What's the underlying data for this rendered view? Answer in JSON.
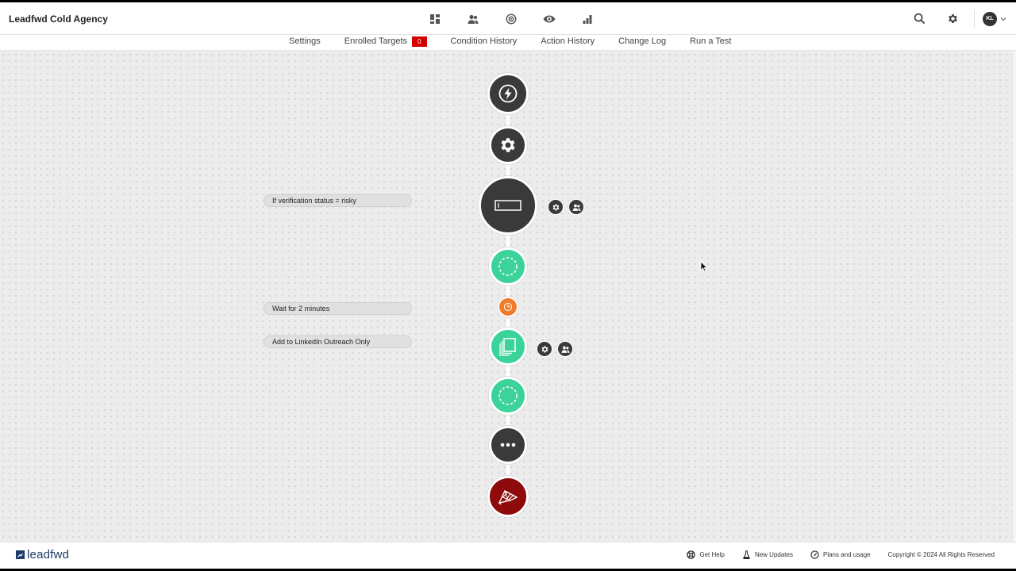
{
  "header": {
    "app_title": "Leadfwd Cold Agency",
    "nav_icons": [
      "dashboard-icon",
      "users-icon",
      "target-icon",
      "eye-icon",
      "bar-chart-icon"
    ],
    "avatar_initials": "KL"
  },
  "tabs": [
    {
      "label": "Settings"
    },
    {
      "label": "Enrolled Targets",
      "badge": "0"
    },
    {
      "label": "Condition History"
    },
    {
      "label": "Action History"
    },
    {
      "label": "Change Log"
    },
    {
      "label": "Run a Test"
    }
  ],
  "workflow": {
    "condition_label": "If verification status = risky",
    "wait_label": "Wait for 2 minutes",
    "action_label": "Add to LinkedIn Outreach Only"
  },
  "footer": {
    "logo_text": "leadfwd",
    "links": [
      {
        "label": "Get Help",
        "icon": "lifebuoy-icon"
      },
      {
        "label": "New Updates",
        "icon": "flask-icon"
      },
      {
        "label": "Plans and usage",
        "icon": "gauge-icon"
      }
    ],
    "copyright": "Copyright © 2024 All Rights Reserved"
  },
  "colors": {
    "node_dark": "#3a3a3a",
    "node_green": "#3bd39a",
    "node_orange": "#f07c2a",
    "node_finish": "#8f0b0b",
    "badge_red": "#d40000",
    "logo_blue": "#1b3a66"
  }
}
